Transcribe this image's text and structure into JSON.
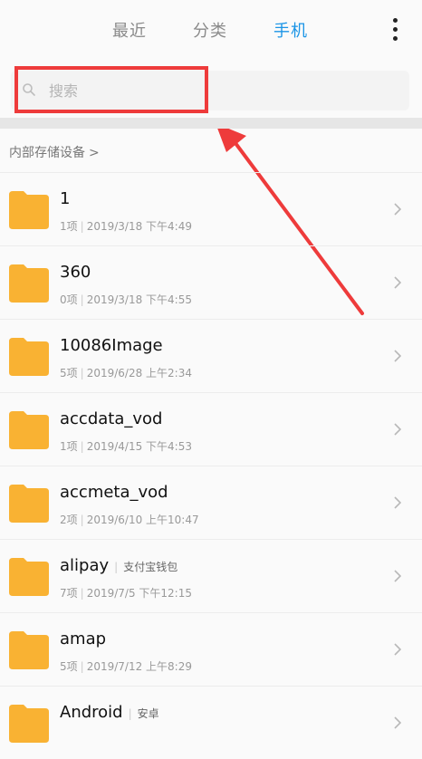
{
  "header": {
    "tabs": [
      {
        "label": "最近",
        "active": false
      },
      {
        "label": "分类",
        "active": false
      },
      {
        "label": "手机",
        "active": true
      }
    ],
    "more_icon": "more-vertical-icon"
  },
  "search": {
    "placeholder": "搜索",
    "value": "",
    "icon": "search-icon"
  },
  "breadcrumb": {
    "label": "内部存储设备",
    "chevron": ">"
  },
  "files": [
    {
      "name": "1",
      "tag": "",
      "count": "1项",
      "date": "2019/3/18 下午4:49"
    },
    {
      "name": "360",
      "tag": "",
      "count": "0项",
      "date": "2019/3/18 下午4:55"
    },
    {
      "name": "10086Image",
      "tag": "",
      "count": "5项",
      "date": "2019/6/28 上午2:34"
    },
    {
      "name": "accdata_vod",
      "tag": "",
      "count": "1项",
      "date": "2019/4/15 下午4:53"
    },
    {
      "name": "accmeta_vod",
      "tag": "",
      "count": "2项",
      "date": "2019/6/10 上午10:47"
    },
    {
      "name": "alipay",
      "tag": "支付宝钱包",
      "count": "7项",
      "date": "2019/7/5 下午12:15"
    },
    {
      "name": "amap",
      "tag": "",
      "count": "5项",
      "date": "2019/7/12 上午8:29"
    },
    {
      "name": "Android",
      "tag": "安卓",
      "count": "",
      "date": ""
    }
  ],
  "colors": {
    "accent": "#1a94e6",
    "folder": "#f9b233",
    "annotation": "#ee3b3b"
  }
}
